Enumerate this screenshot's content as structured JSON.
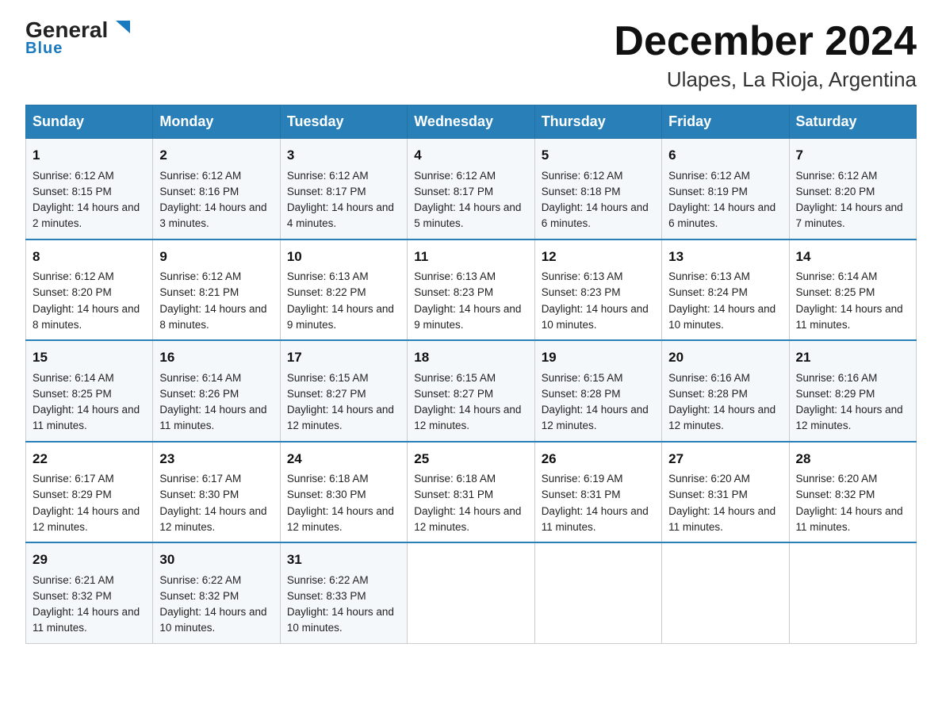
{
  "header": {
    "logo_general": "General",
    "logo_blue": "Blue",
    "title": "December 2024",
    "subtitle": "Ulapes, La Rioja, Argentina"
  },
  "columns": [
    "Sunday",
    "Monday",
    "Tuesday",
    "Wednesday",
    "Thursday",
    "Friday",
    "Saturday"
  ],
  "weeks": [
    [
      {
        "day": "1",
        "sunrise": "Sunrise: 6:12 AM",
        "sunset": "Sunset: 8:15 PM",
        "daylight": "Daylight: 14 hours and 2 minutes."
      },
      {
        "day": "2",
        "sunrise": "Sunrise: 6:12 AM",
        "sunset": "Sunset: 8:16 PM",
        "daylight": "Daylight: 14 hours and 3 minutes."
      },
      {
        "day": "3",
        "sunrise": "Sunrise: 6:12 AM",
        "sunset": "Sunset: 8:17 PM",
        "daylight": "Daylight: 14 hours and 4 minutes."
      },
      {
        "day": "4",
        "sunrise": "Sunrise: 6:12 AM",
        "sunset": "Sunset: 8:17 PM",
        "daylight": "Daylight: 14 hours and 5 minutes."
      },
      {
        "day": "5",
        "sunrise": "Sunrise: 6:12 AM",
        "sunset": "Sunset: 8:18 PM",
        "daylight": "Daylight: 14 hours and 6 minutes."
      },
      {
        "day": "6",
        "sunrise": "Sunrise: 6:12 AM",
        "sunset": "Sunset: 8:19 PM",
        "daylight": "Daylight: 14 hours and 6 minutes."
      },
      {
        "day": "7",
        "sunrise": "Sunrise: 6:12 AM",
        "sunset": "Sunset: 8:20 PM",
        "daylight": "Daylight: 14 hours and 7 minutes."
      }
    ],
    [
      {
        "day": "8",
        "sunrise": "Sunrise: 6:12 AM",
        "sunset": "Sunset: 8:20 PM",
        "daylight": "Daylight: 14 hours and 8 minutes."
      },
      {
        "day": "9",
        "sunrise": "Sunrise: 6:12 AM",
        "sunset": "Sunset: 8:21 PM",
        "daylight": "Daylight: 14 hours and 8 minutes."
      },
      {
        "day": "10",
        "sunrise": "Sunrise: 6:13 AM",
        "sunset": "Sunset: 8:22 PM",
        "daylight": "Daylight: 14 hours and 9 minutes."
      },
      {
        "day": "11",
        "sunrise": "Sunrise: 6:13 AM",
        "sunset": "Sunset: 8:23 PM",
        "daylight": "Daylight: 14 hours and 9 minutes."
      },
      {
        "day": "12",
        "sunrise": "Sunrise: 6:13 AM",
        "sunset": "Sunset: 8:23 PM",
        "daylight": "Daylight: 14 hours and 10 minutes."
      },
      {
        "day": "13",
        "sunrise": "Sunrise: 6:13 AM",
        "sunset": "Sunset: 8:24 PM",
        "daylight": "Daylight: 14 hours and 10 minutes."
      },
      {
        "day": "14",
        "sunrise": "Sunrise: 6:14 AM",
        "sunset": "Sunset: 8:25 PM",
        "daylight": "Daylight: 14 hours and 11 minutes."
      }
    ],
    [
      {
        "day": "15",
        "sunrise": "Sunrise: 6:14 AM",
        "sunset": "Sunset: 8:25 PM",
        "daylight": "Daylight: 14 hours and 11 minutes."
      },
      {
        "day": "16",
        "sunrise": "Sunrise: 6:14 AM",
        "sunset": "Sunset: 8:26 PM",
        "daylight": "Daylight: 14 hours and 11 minutes."
      },
      {
        "day": "17",
        "sunrise": "Sunrise: 6:15 AM",
        "sunset": "Sunset: 8:27 PM",
        "daylight": "Daylight: 14 hours and 12 minutes."
      },
      {
        "day": "18",
        "sunrise": "Sunrise: 6:15 AM",
        "sunset": "Sunset: 8:27 PM",
        "daylight": "Daylight: 14 hours and 12 minutes."
      },
      {
        "day": "19",
        "sunrise": "Sunrise: 6:15 AM",
        "sunset": "Sunset: 8:28 PM",
        "daylight": "Daylight: 14 hours and 12 minutes."
      },
      {
        "day": "20",
        "sunrise": "Sunrise: 6:16 AM",
        "sunset": "Sunset: 8:28 PM",
        "daylight": "Daylight: 14 hours and 12 minutes."
      },
      {
        "day": "21",
        "sunrise": "Sunrise: 6:16 AM",
        "sunset": "Sunset: 8:29 PM",
        "daylight": "Daylight: 14 hours and 12 minutes."
      }
    ],
    [
      {
        "day": "22",
        "sunrise": "Sunrise: 6:17 AM",
        "sunset": "Sunset: 8:29 PM",
        "daylight": "Daylight: 14 hours and 12 minutes."
      },
      {
        "day": "23",
        "sunrise": "Sunrise: 6:17 AM",
        "sunset": "Sunset: 8:30 PM",
        "daylight": "Daylight: 14 hours and 12 minutes."
      },
      {
        "day": "24",
        "sunrise": "Sunrise: 6:18 AM",
        "sunset": "Sunset: 8:30 PM",
        "daylight": "Daylight: 14 hours and 12 minutes."
      },
      {
        "day": "25",
        "sunrise": "Sunrise: 6:18 AM",
        "sunset": "Sunset: 8:31 PM",
        "daylight": "Daylight: 14 hours and 12 minutes."
      },
      {
        "day": "26",
        "sunrise": "Sunrise: 6:19 AM",
        "sunset": "Sunset: 8:31 PM",
        "daylight": "Daylight: 14 hours and 11 minutes."
      },
      {
        "day": "27",
        "sunrise": "Sunrise: 6:20 AM",
        "sunset": "Sunset: 8:31 PM",
        "daylight": "Daylight: 14 hours and 11 minutes."
      },
      {
        "day": "28",
        "sunrise": "Sunrise: 6:20 AM",
        "sunset": "Sunset: 8:32 PM",
        "daylight": "Daylight: 14 hours and 11 minutes."
      }
    ],
    [
      {
        "day": "29",
        "sunrise": "Sunrise: 6:21 AM",
        "sunset": "Sunset: 8:32 PM",
        "daylight": "Daylight: 14 hours and 11 minutes."
      },
      {
        "day": "30",
        "sunrise": "Sunrise: 6:22 AM",
        "sunset": "Sunset: 8:32 PM",
        "daylight": "Daylight: 14 hours and 10 minutes."
      },
      {
        "day": "31",
        "sunrise": "Sunrise: 6:22 AM",
        "sunset": "Sunset: 8:33 PM",
        "daylight": "Daylight: 14 hours and 10 minutes."
      },
      null,
      null,
      null,
      null
    ]
  ]
}
